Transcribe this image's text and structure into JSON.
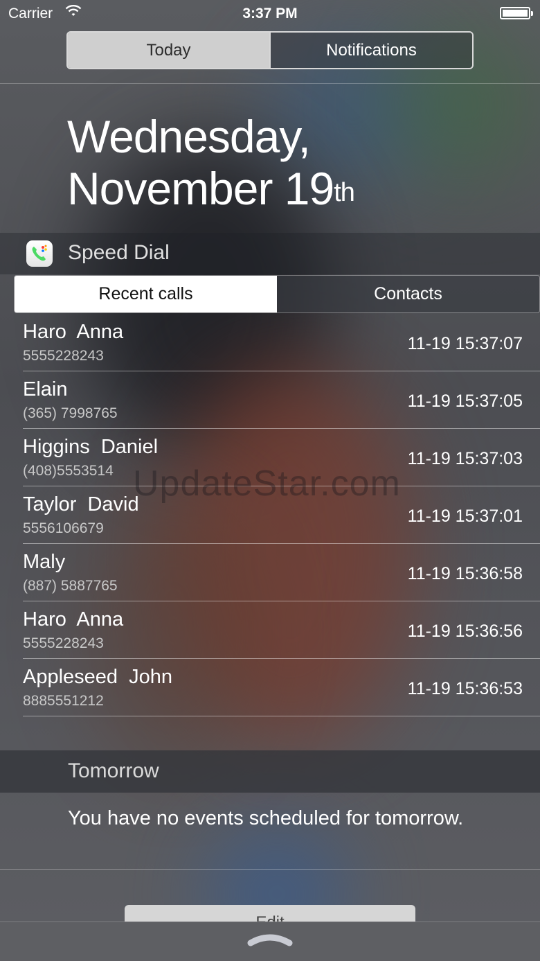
{
  "status_bar": {
    "carrier": "Carrier",
    "time": "3:37 PM"
  },
  "top_segment": {
    "today": "Today",
    "notifications": "Notifications",
    "selected": "Today"
  },
  "date": {
    "weekday_line": "Wednesday,",
    "month_day": "November 19",
    "ordinal_suffix": "th"
  },
  "widget": {
    "title": "Speed Dial",
    "icon": "phone-app-icon",
    "tabs": {
      "recent": "Recent calls",
      "contacts": "Contacts",
      "selected": "Recent calls"
    },
    "calls": [
      {
        "name": "Haro  Anna",
        "number": "5555228243",
        "timestamp": "11-19 15:37:07"
      },
      {
        "name": "Elain",
        "number": "(365) 7998765",
        "timestamp": "11-19 15:37:05"
      },
      {
        "name": "Higgins  Daniel",
        "number": "(408)5553514",
        "timestamp": "11-19 15:37:03"
      },
      {
        "name": "Taylor  David",
        "number": "5556106679",
        "timestamp": "11-19 15:37:01"
      },
      {
        "name": "Maly",
        "number": "(887) 5887765",
        "timestamp": "11-19 15:36:58"
      },
      {
        "name": "Haro  Anna",
        "number": "5555228243",
        "timestamp": "11-19 15:36:56"
      },
      {
        "name": "Appleseed  John",
        "number": "8885551212",
        "timestamp": "11-19 15:36:53"
      }
    ]
  },
  "watermark": "UpdateStar.com",
  "tomorrow": {
    "title": "Tomorrow",
    "message": "You have no events scheduled for tomorrow."
  },
  "edit_label": "Edit",
  "colors": {
    "segment_selected_bg": "#cfcfcf",
    "tab_selected_bg": "#ffffff",
    "phone_green": "#4cd964"
  }
}
